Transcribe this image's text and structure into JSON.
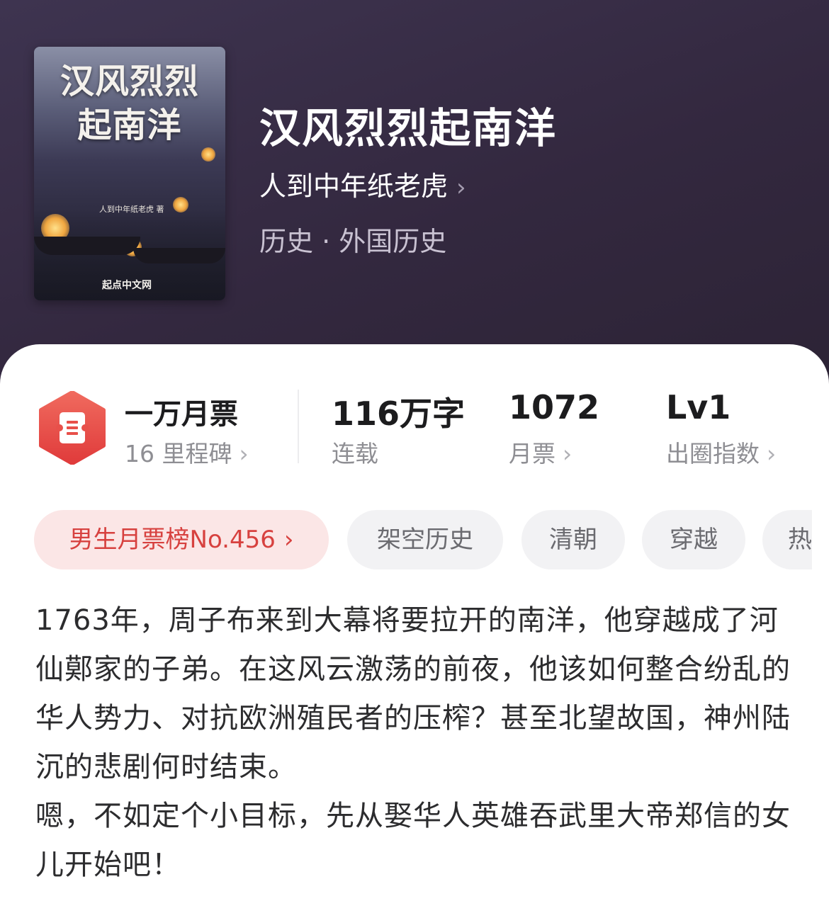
{
  "cover": {
    "title_line1": "汉风烈烈",
    "title_line2": "起南洋",
    "author": "人到中年纸老虎 著",
    "publisher": "起点中文网"
  },
  "book": {
    "title": "汉风烈烈起南洋",
    "author": "人到中年纸老虎",
    "category": "历史 · 外国历史"
  },
  "stats": {
    "milestone": {
      "top": "一万月票",
      "bottom": "16 里程碑"
    },
    "words": {
      "top": "116万字",
      "bottom": "连载"
    },
    "monthly_tickets": {
      "top": "1072",
      "bottom": "月票"
    },
    "level": {
      "top": "Lv1",
      "bottom": "出圈指数"
    }
  },
  "tags": {
    "rank": "男生月票榜No.456",
    "items": [
      "架空历史",
      "清朝",
      "穿越",
      "热"
    ]
  },
  "description": [
    "1763年，周子布来到大幕将要拉开的南洋，他穿越成了河仙鄚家的子弟。在这风云激荡的前夜，他该如何整合纷乱的华人势力、对抗欧洲殖民者的压榨？甚至北望故国，神州陆沉的悲剧何时结束。",
    "嗯，不如定个小目标，先从娶华人英雄吞武里大帝郑信的女儿开始吧！"
  ],
  "icons": {
    "chevron": "›",
    "ticket_badge": "ticket-icon"
  },
  "colors": {
    "header_bg": "#372c44",
    "accent_red": "#e0403f",
    "rank_tag_bg": "#fbe6e6"
  }
}
